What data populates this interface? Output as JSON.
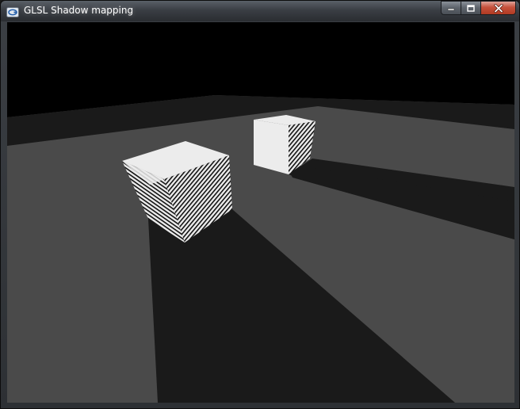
{
  "window": {
    "title": "GLSL Shadow mapping",
    "app_icon": "opengl-window-icon",
    "buttons": {
      "minimize": "minimize-icon",
      "maximize": "maximize-icon",
      "close": "close-icon"
    }
  },
  "scene": {
    "colors": {
      "background": "#000000",
      "floor_lit": "#4a4a4a",
      "floor_shadow": "#1a1a1a",
      "cube_face": "#ececec",
      "cube_acne": "#121212"
    }
  }
}
